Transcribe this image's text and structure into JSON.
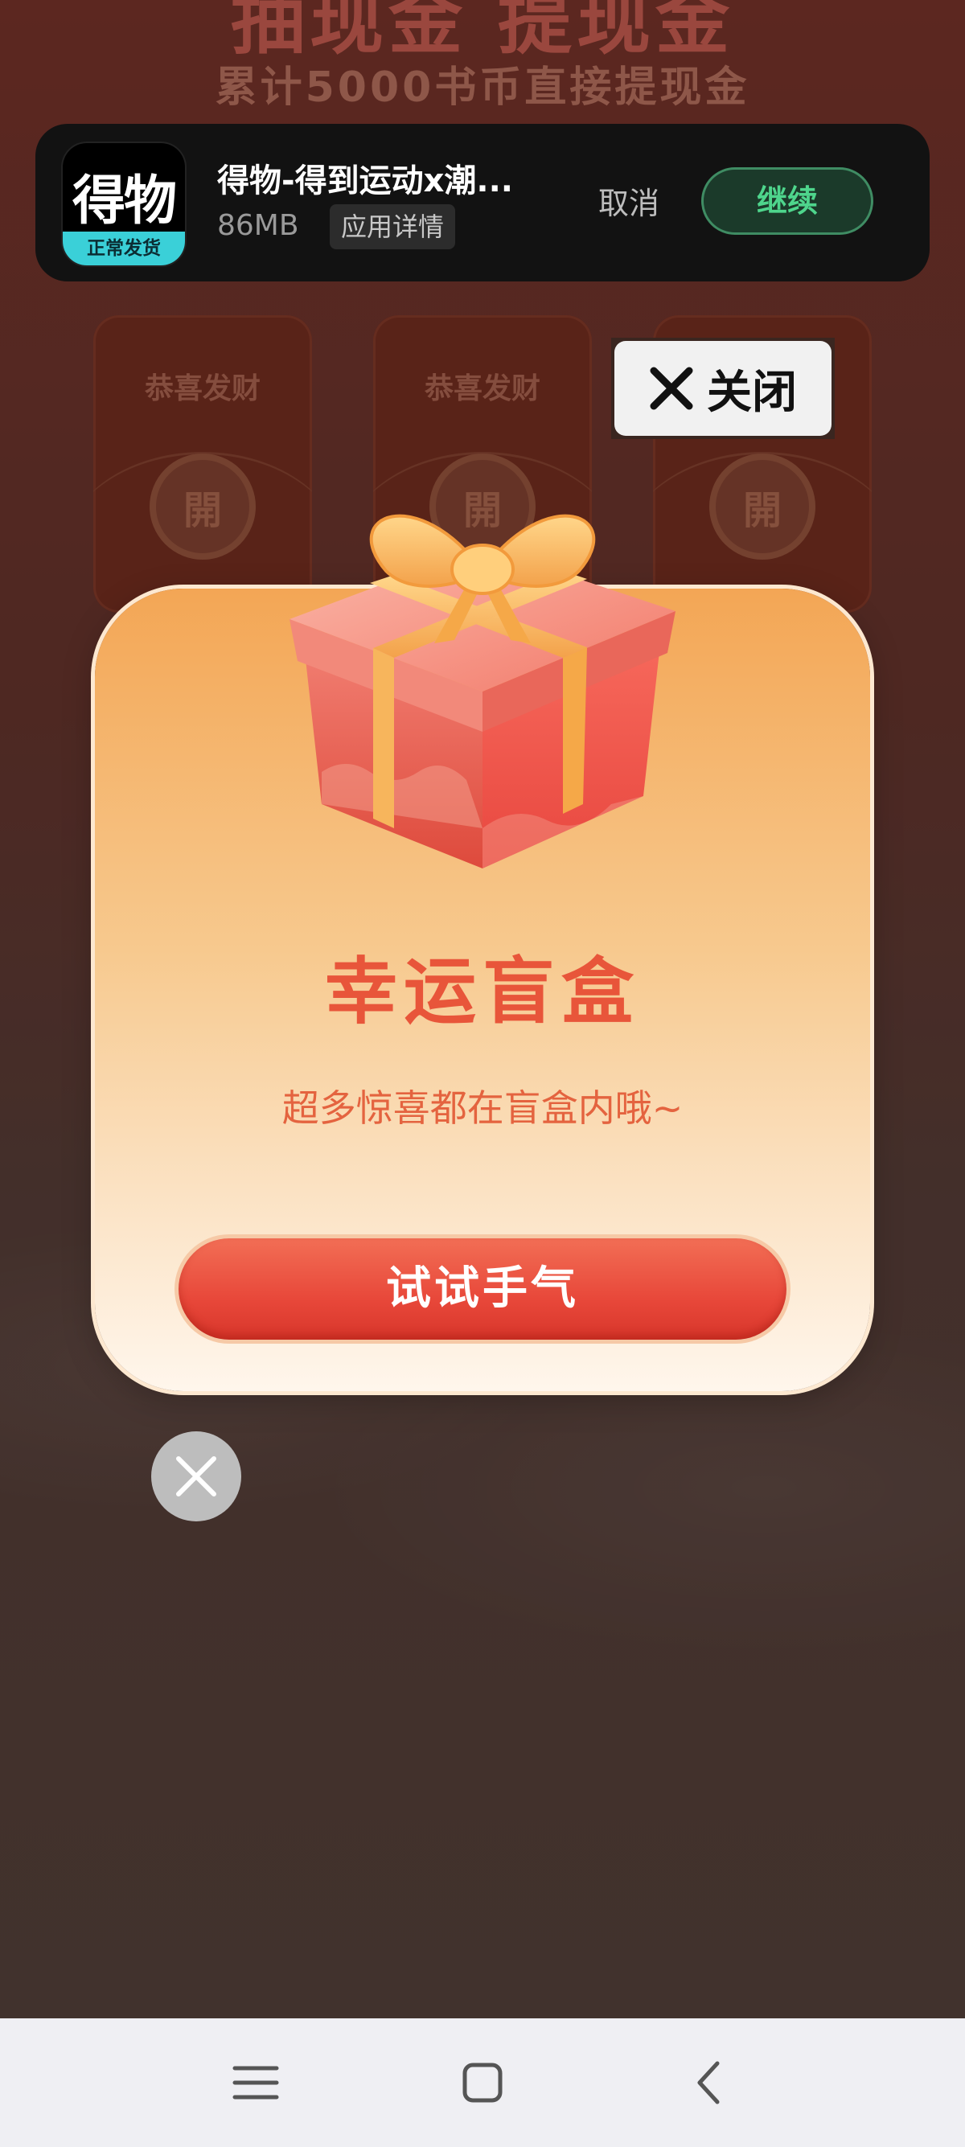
{
  "background": {
    "headline": "抽现金   提现金",
    "subtitle": "累计5000书币直接提现金",
    "envelopes": [
      {
        "title": "恭喜发财",
        "open_label": "開"
      },
      {
        "title": "恭喜发财",
        "open_label": "開"
      },
      {
        "title": "恭喜发财",
        "open_label": "開"
      }
    ]
  },
  "download_banner": {
    "app_icon_text": "得物",
    "app_icon_ribbon": "正常发货",
    "app_name": "得物-得到运动x潮...",
    "app_size": "86MB",
    "details_label": "应用详情",
    "cancel_label": "取消",
    "continue_label": "继续"
  },
  "ad_close": {
    "label": "关闭",
    "icon": "close-icon"
  },
  "modal": {
    "title": "幸运盲盒",
    "subtitle": "超多惊喜都在盲盒内哦~",
    "button_label": "试试手气",
    "illustration": "gift-box"
  },
  "nav_bar": {
    "icons": [
      "menu-icon",
      "home-icon",
      "back-icon"
    ]
  },
  "colors": {
    "accent_red": "#e8553a",
    "button_red": "#e8483a",
    "continue_green": "#4ed58c",
    "banner_bg": "#121212",
    "card_top": "#f3a655"
  }
}
